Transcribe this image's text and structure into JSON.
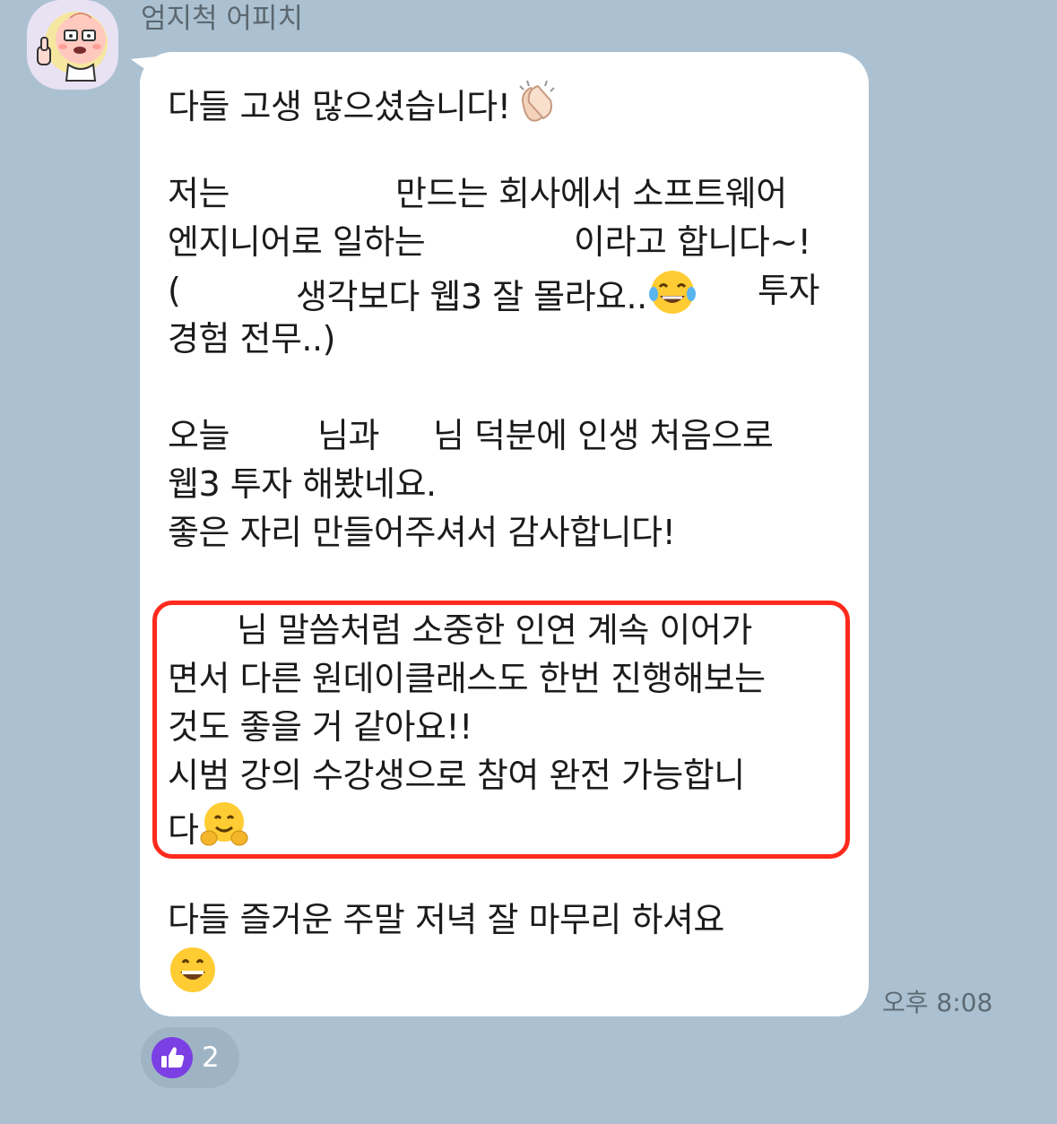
{
  "message": {
    "sender": "엄지척 어피치",
    "avatar_icon": "apeach-thumbs-up-avatar-icon",
    "lines": [
      "다들 고생 많으셨습니다!",
      "저는",
      "만드는 회사에서 소프트웨어",
      "엔지니어로 일하는",
      "이라고 합니다~!",
      "(",
      "생각보다 웹3 잘 몰라요..",
      "투자",
      "경험 전무..)",
      "오늘",
      "님과",
      "님 덕분에 인생 처음으로",
      "웹3 투자 해봤네요.",
      "좋은 자리 만들어주셔서 감사합니다!",
      "님 말씀처럼 소중한 인연 계속 이어가",
      "면서 다른 원데이클래스도 한번 진행해보는",
      "것도 좋을 거 같아요!!",
      "시범 강의 수강생으로 참여 완전 가능합니",
      "다",
      "다들 즐거운 주말 저녁 잘 마무리 하셔요"
    ],
    "emojis": {
      "clap": "clapping-hands-icon",
      "tears_of_joy": "face-with-tears-of-joy-icon",
      "hugging": "hugging-face-icon",
      "grinning": "grinning-face-icon"
    },
    "highlight_color": "#ff2a1d",
    "timestamp": "오후 8:08"
  },
  "reaction": {
    "icon": "thumbs-up-icon",
    "count": "2",
    "color": "#7b3fe4"
  },
  "colors": {
    "background": "#abc1d1",
    "bubble": "#ffffff"
  }
}
